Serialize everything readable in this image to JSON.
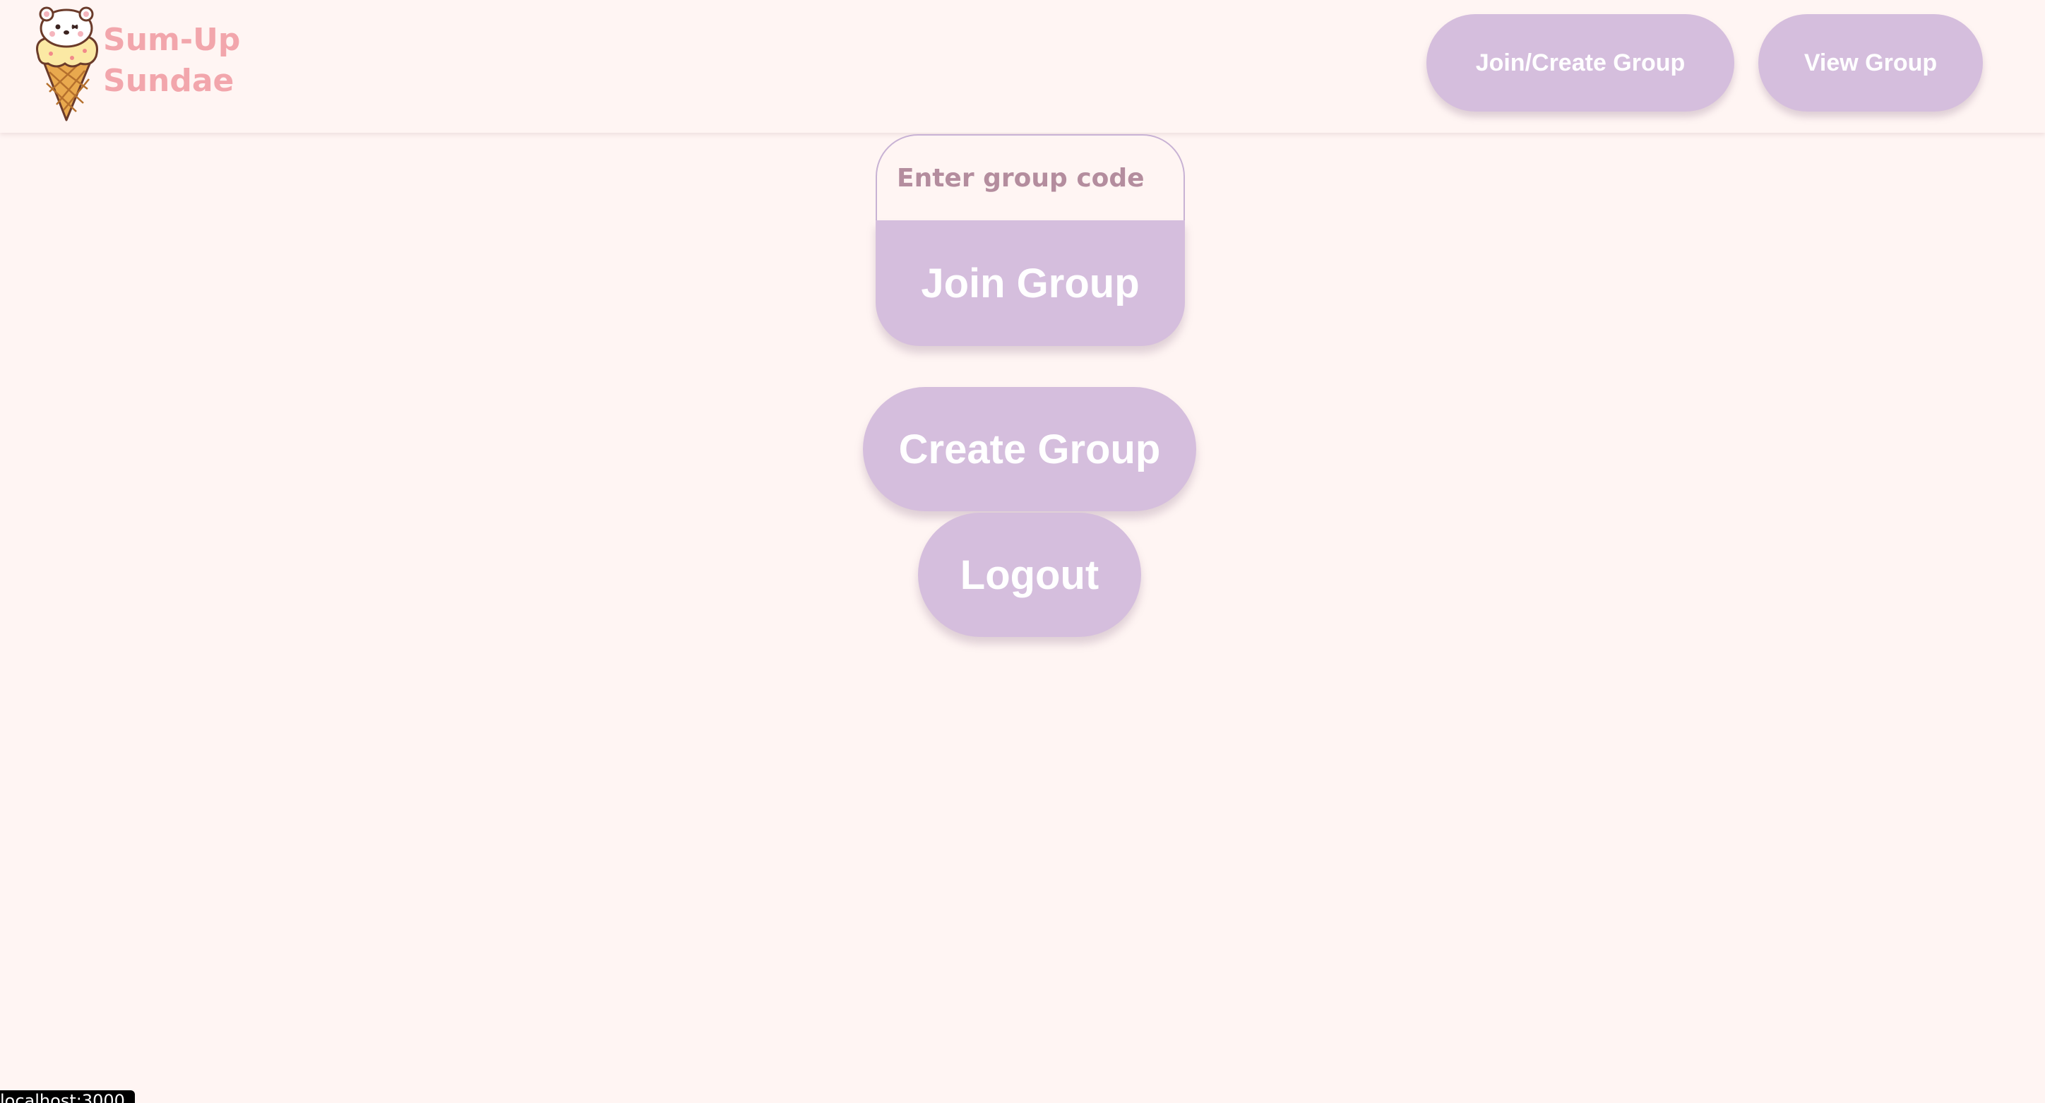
{
  "brand": {
    "line1": "Sum-Up",
    "line2": "Sundae",
    "logo_icon": "ice-cream-bear-icon"
  },
  "nav": {
    "join_create_label": "Join/Create Group",
    "view_label": "View Group"
  },
  "join": {
    "placeholder": "Enter group code",
    "value": "",
    "button_label": "Join Group"
  },
  "actions": {
    "create_label": "Create Group",
    "logout_label": "Logout"
  },
  "status_bar": {
    "text": "localhost:3000"
  },
  "colors": {
    "background": "#fff5f3",
    "button": "#d5bedd",
    "brand_text": "#f2a6ac",
    "button_text": "#ffffff"
  }
}
